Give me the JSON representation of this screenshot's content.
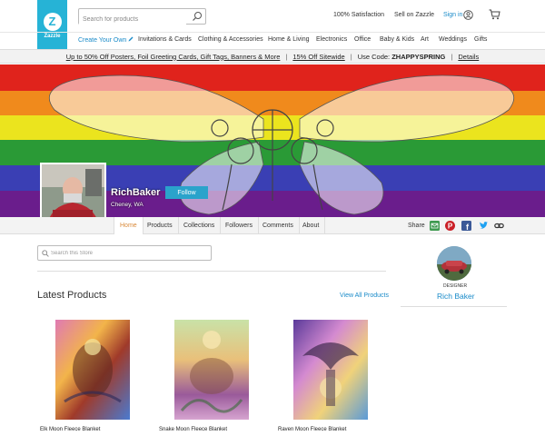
{
  "header": {
    "logo_text": "Zazzle",
    "search_placeholder": "Search for products",
    "satisfaction": "100% Satisfaction",
    "sell": "Sell on Zazzle",
    "sign_in": "Sign in"
  },
  "categories": [
    "Create Your Own",
    "Invitations & Cards",
    "Clothing & Accessories",
    "Home & Living",
    "Electronics",
    "Office",
    "Baby & Kids",
    "Art",
    "Weddings",
    "Gifts"
  ],
  "promo": {
    "offer1": "Up to 50% Off Posters, Foil Greeting Cards, Gift Tags, Banners & More",
    "offer2": "15% Off Sitewide",
    "code_label": "Use Code:",
    "code": "ZHAPPYSPRING",
    "details": "Details"
  },
  "store": {
    "name": "RichBaker",
    "location": "Cheney, WA",
    "follow": "Follow"
  },
  "store_nav": {
    "home": "Home",
    "products": "Products",
    "collections": "Collections",
    "followers": "Followers",
    "comments": "Comments",
    "about": "About",
    "share": "Share"
  },
  "store_search_placeholder": "Search this Store",
  "latest": {
    "title": "Latest Products",
    "view_all": "View All Products",
    "products": [
      {
        "name": "Elk Moon Fleece Blanket"
      },
      {
        "name": "Snake Moon Fleece Blanket"
      },
      {
        "name": "Raven Moon Fleece Blanket"
      }
    ]
  },
  "designer": {
    "label": "DESIGNER",
    "name": "Rich Baker"
  },
  "colors": {
    "brand": "#26b3d6",
    "link": "#1a8bc9",
    "follow": "#2aa3cb",
    "home_tab": "#d98a3a"
  }
}
